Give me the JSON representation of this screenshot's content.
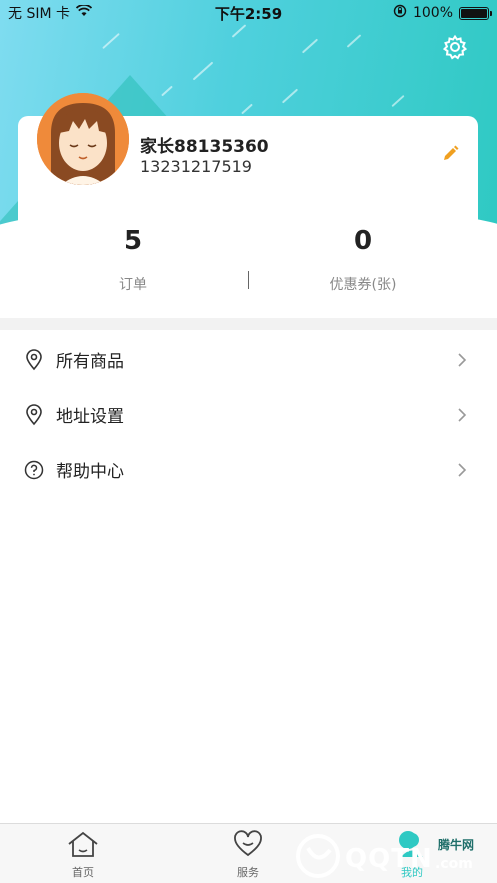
{
  "status_bar": {
    "carrier": "无 SIM 卡",
    "time": "下午2:59",
    "battery": "100%"
  },
  "profile": {
    "name": "家长88135360",
    "phone": "13231217519"
  },
  "stats": [
    {
      "value": "5",
      "label": "订单"
    },
    {
      "value": "0",
      "label": "优惠券(张)"
    }
  ],
  "menu": [
    {
      "label": "所有商品",
      "icon": "location-pin-icon"
    },
    {
      "label": "地址设置",
      "icon": "location-pin-icon"
    },
    {
      "label": "帮助中心",
      "icon": "question-circle-icon"
    }
  ],
  "tabbar": [
    {
      "label": "首页",
      "icon": "home-icon"
    },
    {
      "label": "服务",
      "icon": "heart-icon"
    },
    {
      "label": "我的",
      "icon": "profile-icon"
    }
  ],
  "watermark": {
    "brand": "QQTN",
    "suffix": ".com",
    "site_name": "腾牛网"
  },
  "colors": {
    "header_start": "#7fdcf0",
    "header_end": "#2fc9c3",
    "avatar_bg": "#ef8a3a",
    "edit_icon": "#f0a020",
    "active_tab": "#2fc9c3"
  }
}
